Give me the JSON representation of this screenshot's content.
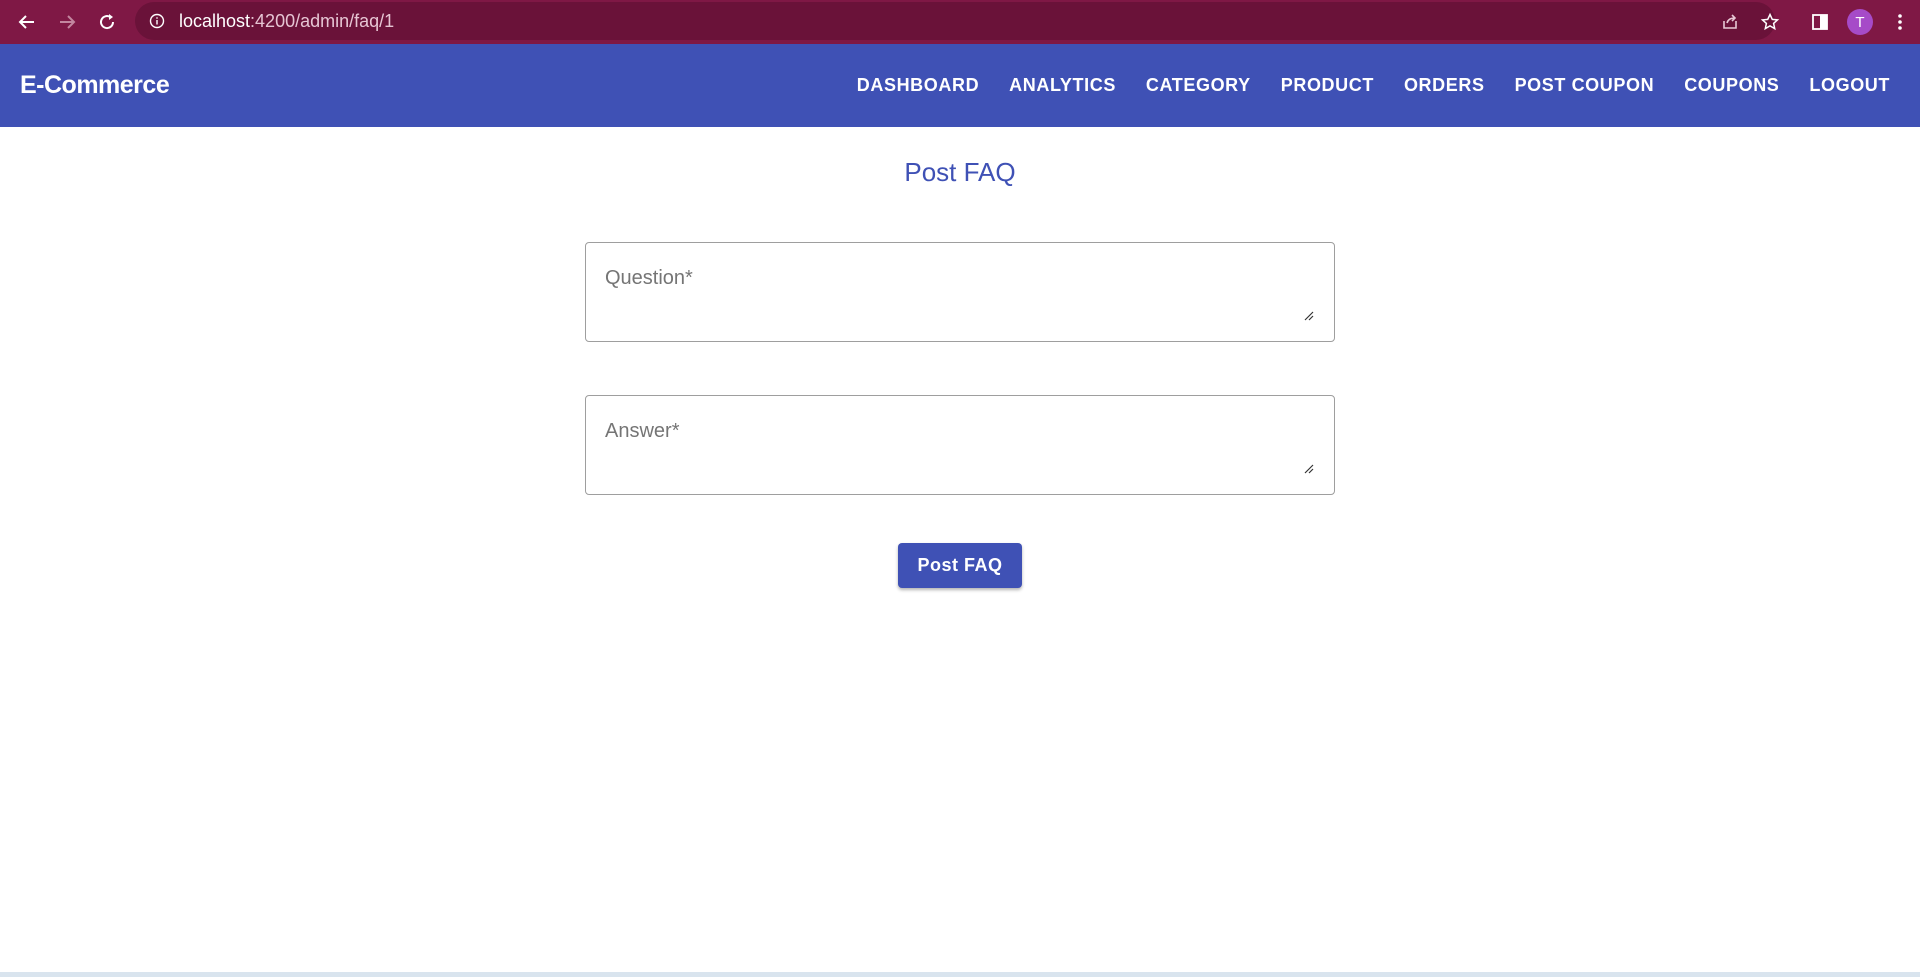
{
  "browser": {
    "url_host": "localhost",
    "url_path": ":4200/admin/faq/1",
    "profile_initial": "T"
  },
  "toolbar": {
    "app_title": "E-Commerce",
    "nav": [
      {
        "label": "DASHBOARD"
      },
      {
        "label": "ANALYTICS"
      },
      {
        "label": "CATEGORY"
      },
      {
        "label": "PRODUCT"
      },
      {
        "label": "ORDERS"
      },
      {
        "label": "POST COUPON"
      },
      {
        "label": "COUPONS"
      },
      {
        "label": "LOGOUT"
      }
    ]
  },
  "main": {
    "title": "Post FAQ",
    "question": {
      "placeholder": "Question*",
      "value": ""
    },
    "answer": {
      "placeholder": "Answer*",
      "value": ""
    },
    "submit_label": "Post FAQ"
  },
  "colors": {
    "chrome_bar": "#7f1845",
    "primary": "#3f51b5",
    "field_border": "#9e9e9e",
    "placeholder": "#757575"
  }
}
